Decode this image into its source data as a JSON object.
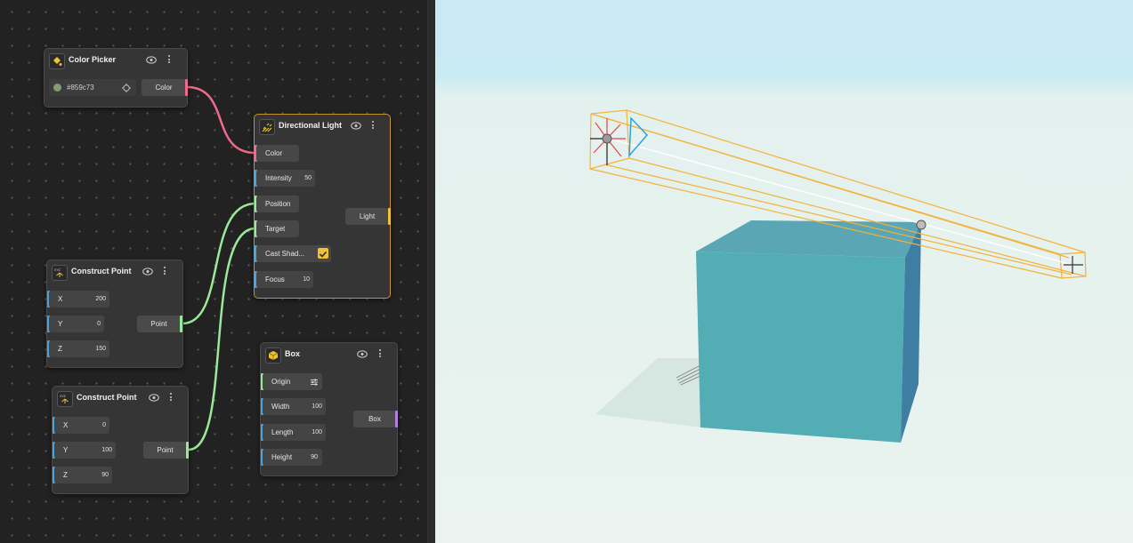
{
  "colors": {
    "blue_port": "#4aa3df",
    "green_port": "#9be89b",
    "pink_port": "#f06a8b",
    "yellow_port": "#f2c230",
    "purple_port": "#b07fd8",
    "swatch": "#859c73",
    "box_top": "#5aa6b5",
    "box_front": "#52adb4",
    "box_side": "#3f7ea3",
    "frustum": "#f5b23a"
  },
  "nodes": {
    "color_picker": {
      "title": "Color Picker",
      "icon": "color-bucket-icon",
      "hex_value": "#859c73",
      "output": "Color"
    },
    "directional_light": {
      "title": "Directional Light",
      "icon": "sun-rays-icon",
      "inputs": {
        "color": "Color",
        "intensity": "Intensity",
        "intensity_value": "50",
        "position": "Position",
        "target": "Target",
        "cast_shadow": "Cast Shad...",
        "cast_shadow_checked": true,
        "focus": "Focus",
        "focus_value": "10"
      },
      "output": "Light"
    },
    "construct_point_1": {
      "title": "Construct Point",
      "icon": "xyz-axes-icon",
      "x_label": "X",
      "x_value": "200",
      "y_label": "Y",
      "y_value": "0",
      "z_label": "Z",
      "z_value": "150",
      "output": "Point"
    },
    "construct_point_2": {
      "title": "Construct Point",
      "icon": "xyz-axes-icon",
      "x_label": "X",
      "x_value": "0",
      "y_label": "Y",
      "y_value": "100",
      "z_label": "Z",
      "z_value": "90",
      "output": "Point"
    },
    "box": {
      "title": "Box",
      "icon": "cube-icon",
      "origin": "Origin",
      "width": "Width",
      "width_value": "100",
      "length": "Length",
      "length_value": "100",
      "height": "Height",
      "height_value": "90",
      "output": "Box"
    }
  }
}
